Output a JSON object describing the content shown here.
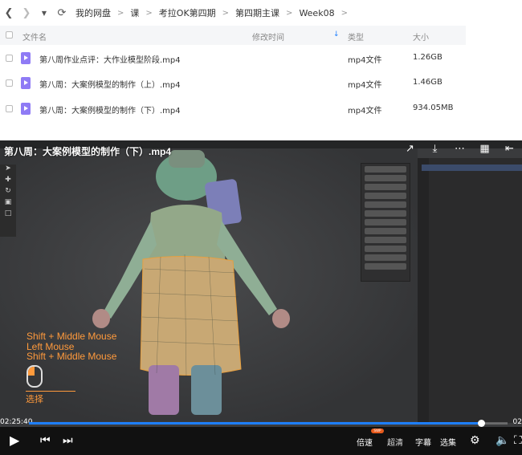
{
  "nav": {
    "breadcrumbs": [
      "我的网盘",
      "课",
      "考拉OK第四期",
      "第四期主课",
      "Week08"
    ]
  },
  "table": {
    "headers": {
      "name": "文件名",
      "modified": "修改时间",
      "type": "类型",
      "size": "大小"
    },
    "rows": [
      {
        "name": "第八周作业点评：大作业模型阶段.mp4",
        "type": "mp4文件",
        "size": "1.26GB"
      },
      {
        "name": "第八周：大案例模型的制作（上）.mp4",
        "type": "mp4文件",
        "size": "1.46GB"
      },
      {
        "name": "第八周：大案例模型的制作（下）.mp4",
        "type": "mp4文件",
        "size": "934.05MB"
      }
    ]
  },
  "player": {
    "title": "第八周：大案例模型的制作（下）.mp4",
    "hints": [
      "Shift + Middle Mouse",
      "Left Mouse",
      "Shift + Middle Mouse"
    ],
    "select_label": "选择",
    "current_time": "02:25:40",
    "total_time": "02",
    "progress": 0.945,
    "controls": {
      "speed": "倍速",
      "quality": "超清",
      "subtitle": "字幕",
      "episodes": "选集",
      "swp": "SWP"
    },
    "colors": {
      "accent": "#1e7fff",
      "hint": "#ff9a3c"
    }
  }
}
